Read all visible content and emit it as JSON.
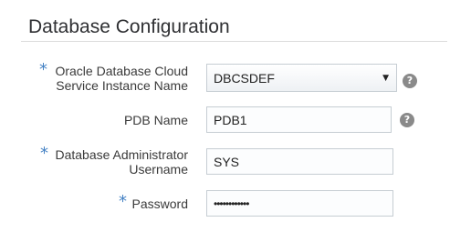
{
  "section": {
    "title": "Database Configuration"
  },
  "fields": {
    "instance": {
      "required_mark": "*",
      "label_line1": "Oracle Database Cloud",
      "label_line2": "Service Instance Name",
      "value": "DBCSDEF",
      "arrow": "▼",
      "help": "?"
    },
    "pdb": {
      "label": "PDB Name",
      "value": "PDB1",
      "help": "?"
    },
    "admin_user": {
      "required_mark": "*",
      "label_line1": "Database Administrator",
      "label_line2": "Username",
      "value": "SYS"
    },
    "password": {
      "required_mark": "*",
      "label": "Password",
      "masked_value": "••••••••••••"
    }
  },
  "icons": {
    "help": "help-icon",
    "dropdown": "chevron-down-icon",
    "required": "required-asterisk"
  },
  "colors": {
    "required": "#4582c4",
    "help_icon": "#8a8a8a",
    "field_border": "#c6cdd3",
    "divider": "#dcdcdc"
  }
}
